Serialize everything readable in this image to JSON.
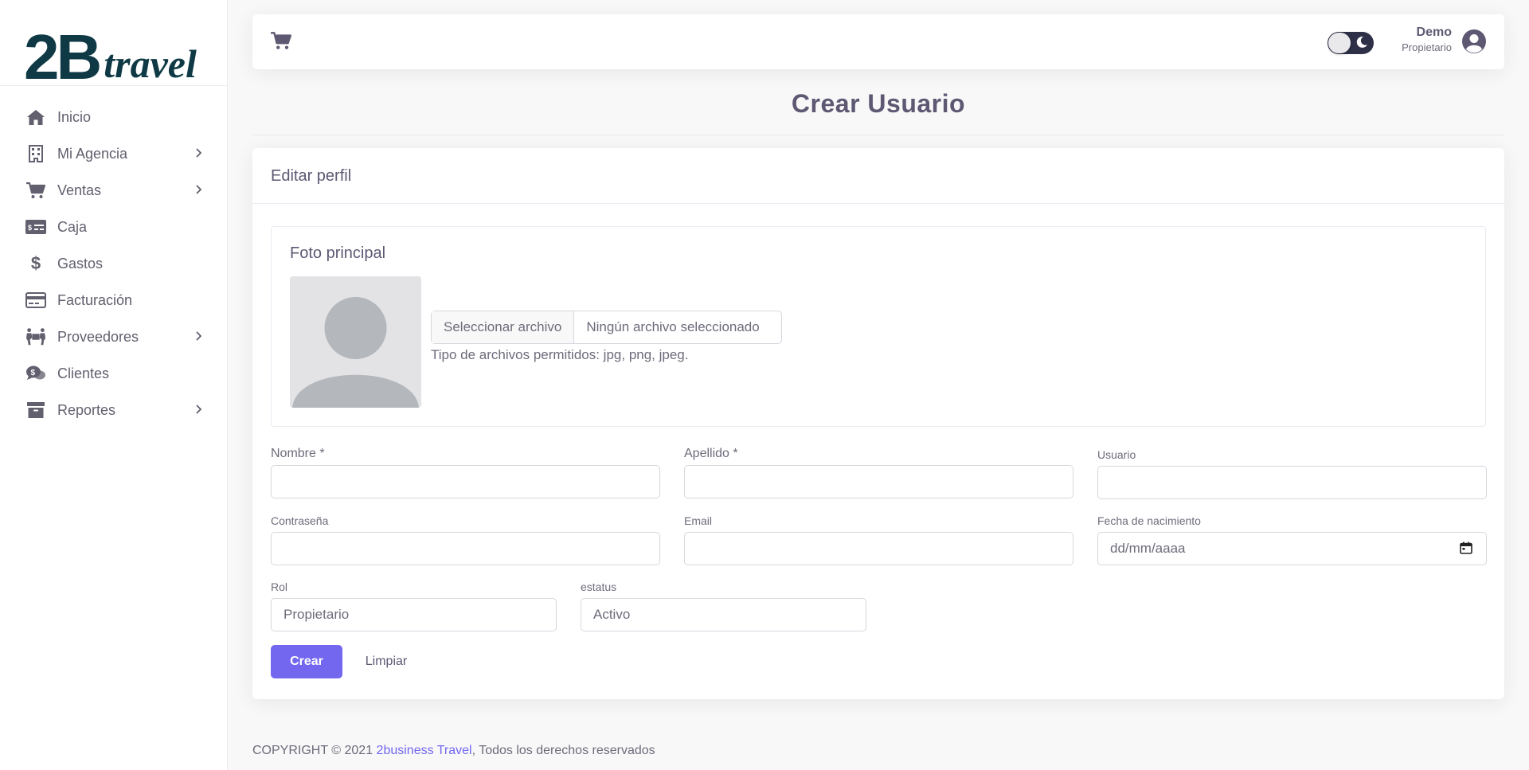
{
  "brand": {
    "logo_main": "2B",
    "logo_sub": "travel"
  },
  "sidebar": {
    "items": [
      {
        "label": "Inicio",
        "icon": "home-icon",
        "has_submenu": false
      },
      {
        "label": "Mi Agencia",
        "icon": "building-icon",
        "has_submenu": true
      },
      {
        "label": "Ventas",
        "icon": "cart-icon",
        "has_submenu": true
      },
      {
        "label": "Caja",
        "icon": "money-check-icon",
        "has_submenu": false
      },
      {
        "label": "Gastos",
        "icon": "dollar-icon",
        "has_submenu": false
      },
      {
        "label": "Facturación",
        "icon": "credit-card-icon",
        "has_submenu": false
      },
      {
        "label": "Proveedores",
        "icon": "people-carry-icon",
        "has_submenu": true
      },
      {
        "label": "Clientes",
        "icon": "comments-dollar-icon",
        "has_submenu": false
      },
      {
        "label": "Reportes",
        "icon": "archive-icon",
        "has_submenu": true
      }
    ]
  },
  "header": {
    "user_name": "Demo",
    "user_role": "Propietario",
    "theme_toggle": "dark-mode-toggle"
  },
  "page": {
    "title": "Crear Usuario"
  },
  "card": {
    "title": "Editar perfil",
    "photo": {
      "title": "Foto principal",
      "file_button": "Seleccionar archivo",
      "file_status": "Ningún archivo seleccionado",
      "help": "Tipo de archivos permitidos: jpg, png, jpeg."
    },
    "fields": {
      "nombre": {
        "label": "Nombre *",
        "value": ""
      },
      "apellido": {
        "label": "Apellido *",
        "value": ""
      },
      "usuario": {
        "label": "Usuario",
        "value": ""
      },
      "contrasena": {
        "label": "Contraseña",
        "value": ""
      },
      "email": {
        "label": "Email",
        "value": ""
      },
      "fecha": {
        "label": "Fecha de nacimiento",
        "placeholder": "dd/mm/aaaa"
      },
      "rol": {
        "label": "Rol",
        "value": "Propietario"
      },
      "estatus": {
        "label": "estatus",
        "value": "Activo"
      }
    },
    "buttons": {
      "create": "Crear",
      "clear": "Limpiar"
    }
  },
  "footer": {
    "prefix": "COPYRIGHT © 2021 ",
    "link": "2business Travel",
    "suffix": ", Todos los derechos reservados"
  },
  "colors": {
    "primary": "#7367f0",
    "brand": "#0f3a45",
    "text": "#6e6b7b"
  }
}
